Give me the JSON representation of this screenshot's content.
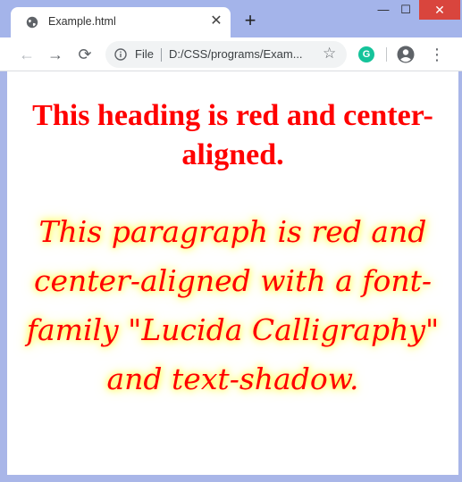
{
  "tab": {
    "title": "Example.html",
    "close_glyph": "✕",
    "icon": "globe-icon"
  },
  "new_tab_glyph": "+",
  "window_controls": {
    "minimize": "—",
    "maximize": "☐",
    "close": "✕"
  },
  "toolbar": {
    "back_glyph": "←",
    "forward_glyph": "→",
    "reload_glyph": "⟳",
    "site_label": "File",
    "url": "D:/CSS/programs/Exam...",
    "star_glyph": "☆",
    "extension_letter": "G",
    "menu_glyph": "⋮"
  },
  "page": {
    "heading": "This heading is red and center-aligned.",
    "paragraph": "This paragraph is red and center-aligned with a font-family \"Lucida Calligraphy\" and text-shadow."
  },
  "colors": {
    "text": "#ff0000",
    "shadow": "#ffff00",
    "frame": "#a9b6e8",
    "close_button": "#d9453d"
  }
}
